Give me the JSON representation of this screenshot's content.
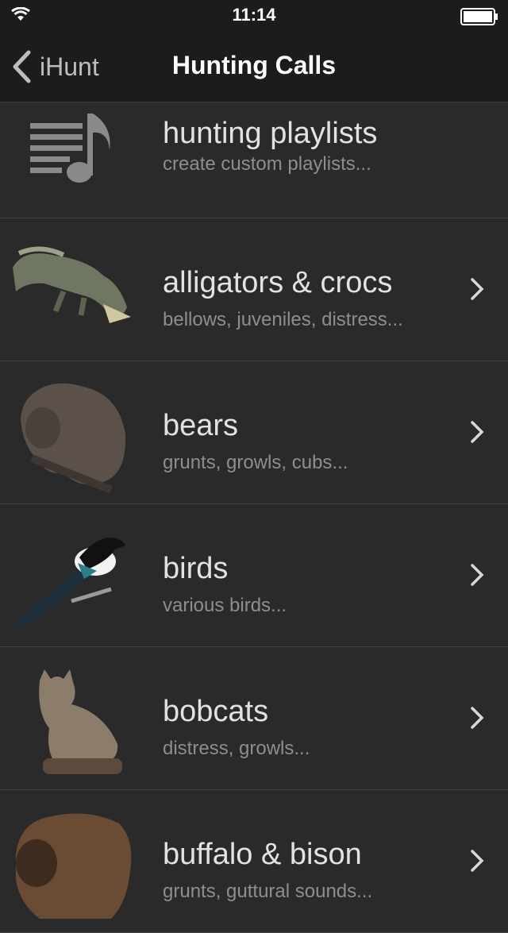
{
  "status": {
    "time": "11:14"
  },
  "nav": {
    "back_label": "iHunt",
    "title": "Hunting Calls"
  },
  "rows": [
    {
      "title": "hunting playlists",
      "subtitle": "create custom playlists..."
    },
    {
      "title": "alligators & crocs",
      "subtitle": "bellows, juveniles, distress..."
    },
    {
      "title": "bears",
      "subtitle": "grunts, growls, cubs..."
    },
    {
      "title": "birds",
      "subtitle": "various birds..."
    },
    {
      "title": "bobcats",
      "subtitle": "distress, growls..."
    },
    {
      "title": "buffalo & bison",
      "subtitle": "grunts, guttural sounds..."
    }
  ],
  "icons": {
    "wifi": "wifi-icon",
    "battery": "battery-icon",
    "back": "chevron-left-icon",
    "row_chevron": "chevron-right-icon",
    "playlist": "music-playlist-icon"
  },
  "colors": {
    "background": "#2a2a2b",
    "bar": "#1c1c1d",
    "title_text": "#e2e2e2",
    "subtitle_text": "#8e8e90"
  }
}
